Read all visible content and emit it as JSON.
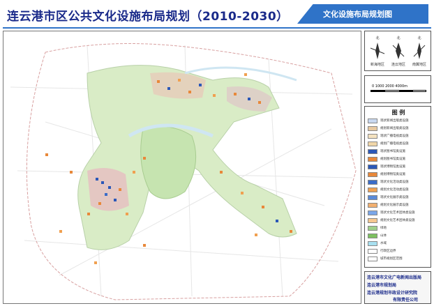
{
  "title": "连云港市区公共文化设施布局规划（2010-2030）",
  "tab_title": "文化设施布局规划图",
  "colors": {
    "accent": "#2f73c8",
    "title": "#1a2a8a",
    "park": "#d9ecc6",
    "water": "#dfeef7"
  },
  "roses": [
    {
      "north": "北",
      "caption": "新海地区",
      "icon": "wind-rose-icon"
    },
    {
      "north": "北",
      "caption": "连云地区",
      "icon": "wind-rose-icon"
    },
    {
      "north": "北",
      "caption": "南翼地区",
      "icon": "wind-rose-icon"
    }
  ],
  "scale": {
    "label": "0  1000 2000    4000m"
  },
  "legend": {
    "title": "图  例",
    "items": [
      {
        "label": "现状新闻出版类设施",
        "color": "#c8d8f0"
      },
      {
        "label": "规划新闻出版类设施",
        "color": "#e8c9a0"
      },
      {
        "label": "现状广播电视类设施",
        "color": "#f4e2c0"
      },
      {
        "label": "规划广播电视类设施",
        "color": "#f0d6a8"
      },
      {
        "label": "现状图书馆类设施",
        "color": "#2b58b8"
      },
      {
        "label": "规划图书馆类设施",
        "color": "#e8883a"
      },
      {
        "label": "现状博物馆类设施",
        "color": "#2b58b8"
      },
      {
        "label": "规划博物馆类设施",
        "color": "#e8883a"
      },
      {
        "label": "现状文化活动类设施",
        "color": "#3a6cc8"
      },
      {
        "label": "规划文化活动类设施",
        "color": "#f0a050"
      },
      {
        "label": "现状文化展示类设施",
        "color": "#5a8ad8"
      },
      {
        "label": "规划文化展示类设施",
        "color": "#f2b070"
      },
      {
        "label": "现状文化艺术团体类设施",
        "color": "#7aa6e8"
      },
      {
        "label": "规划文化艺术团体类设施",
        "color": "#f6c890"
      },
      {
        "label": "绿地",
        "color": "#9fd08a"
      },
      {
        "label": "山体",
        "color": "#7cc060"
      },
      {
        "label": "水域",
        "color": "#a8e0f0"
      },
      {
        "label": "行政区边界",
        "color": "#ffffff"
      },
      {
        "label": "城市规划区范围",
        "color": "#ffffff"
      }
    ]
  },
  "credits": [
    "连云港市文化广电新闻出版局",
    "连云港市规划局",
    "连云港规划市政设计研究院",
    "有限责任公司"
  ]
}
